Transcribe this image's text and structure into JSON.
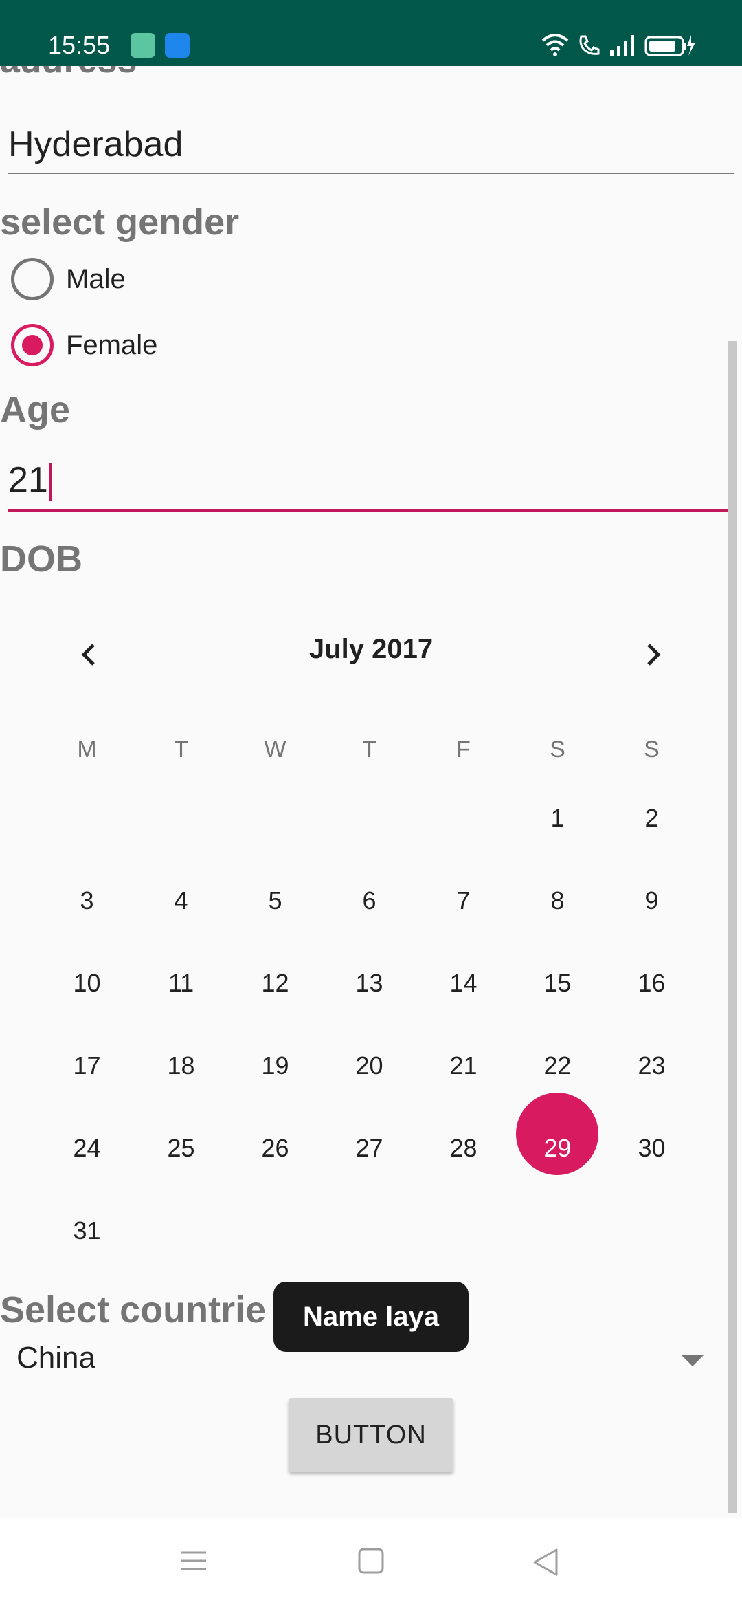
{
  "status_bar": {
    "time": "15:55"
  },
  "form": {
    "address_label": "address",
    "address_value": "Hyderabad",
    "gender_label": "select gender",
    "gender_options": [
      "Male",
      "Female"
    ],
    "age_label": "Age",
    "age_value": "21",
    "dob_label": "DOB",
    "countries_label": "Select countrie",
    "country_value": "China",
    "button_label": "BUTTON"
  },
  "calendar": {
    "month_title": "July 2017",
    "day_headers": [
      "M",
      "T",
      "W",
      "T",
      "F",
      "S",
      "S"
    ],
    "weeks": [
      [
        "",
        "",
        "",
        "",
        "",
        "1",
        "2"
      ],
      [
        "3",
        "4",
        "5",
        "6",
        "7",
        "8",
        "9"
      ],
      [
        "10",
        "11",
        "12",
        "13",
        "14",
        "15",
        "16"
      ],
      [
        "17",
        "18",
        "19",
        "20",
        "21",
        "22",
        "23"
      ],
      [
        "24",
        "25",
        "26",
        "27",
        "28",
        "29",
        "30"
      ],
      [
        "31",
        "",
        "",
        "",
        "",
        "",
        ""
      ]
    ],
    "selected_day": "29"
  },
  "toast": {
    "text": "Name laya"
  },
  "colors": {
    "status_bar": "#01584a",
    "accent": "#d81b60",
    "background": "#fafafa"
  }
}
